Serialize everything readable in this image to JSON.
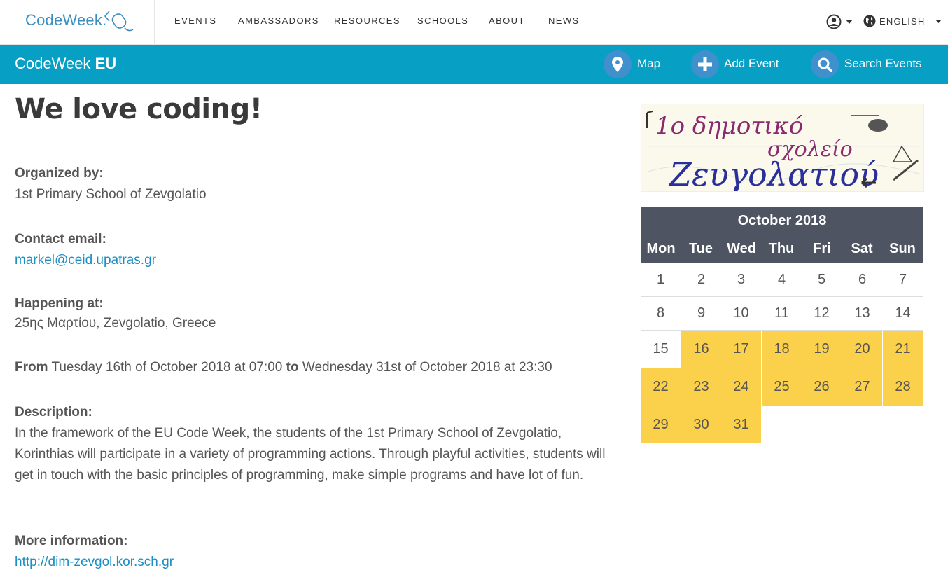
{
  "app": {
    "logo_text": "CodeWeek.",
    "brand_light": "CodeWeek",
    "brand_bold": "EU"
  },
  "nav": {
    "items": [
      "EVENTS",
      "AMBASSADORS",
      "RESOURCES",
      "SCHOOLS",
      "ABOUT",
      "NEWS"
    ],
    "language": "ENGLISH"
  },
  "actions": {
    "map": "Map",
    "add_event": "Add Event",
    "search_events": "Search Events"
  },
  "event": {
    "title": "We love coding!",
    "organized_by_label": "Organized by:",
    "organizer": "1st Primary School of Zevgolatio",
    "contact_label": "Contact email:",
    "contact_email": "markel@ceid.upatras.gr",
    "happening_label": "Happening at:",
    "location": "25ης Μαρτίου, Zevgolatio, Greece",
    "from_label": "From",
    "from_value": "Tuesday 16th of October 2018 at 07:00",
    "to_label": "to",
    "to_value": "Wednesday 31st of October 2018 at 23:30",
    "description_label": "Description:",
    "description": "In the framework of the EU Code Week, the students of the 1st Primary School of Zevgolatio, Korinthias will participate in a variety of programming actions. Through playful activities, students will get in touch with the basic principles of programming, make simple programs and have lot of fun.",
    "more_info_label": "More information:",
    "more_info_url": "http://dim-zevgol.kor.sch.gr"
  },
  "image_text": "1ο δημοτικό σχολείο Ζευγολατιού",
  "calendar": {
    "month": "October 2018",
    "weekdays": [
      "Mon",
      "Tue",
      "Wed",
      "Thu",
      "Fri",
      "Sat",
      "Sun"
    ],
    "days": [
      "1",
      "2",
      "3",
      "4",
      "5",
      "6",
      "7",
      "8",
      "9",
      "10",
      "11",
      "12",
      "13",
      "14",
      "15",
      "16",
      "17",
      "18",
      "19",
      "20",
      "21",
      "22",
      "23",
      "24",
      "25",
      "26",
      "27",
      "28",
      "29",
      "30",
      "31"
    ],
    "highlight_from": 16,
    "highlight_to": 31
  },
  "colors": {
    "brand_blue": "#089fc5",
    "action_circle": "#3f90cc",
    "calendar_header": "#4e5461",
    "highlight": "#fbd14b",
    "link": "#1a8fc4"
  }
}
